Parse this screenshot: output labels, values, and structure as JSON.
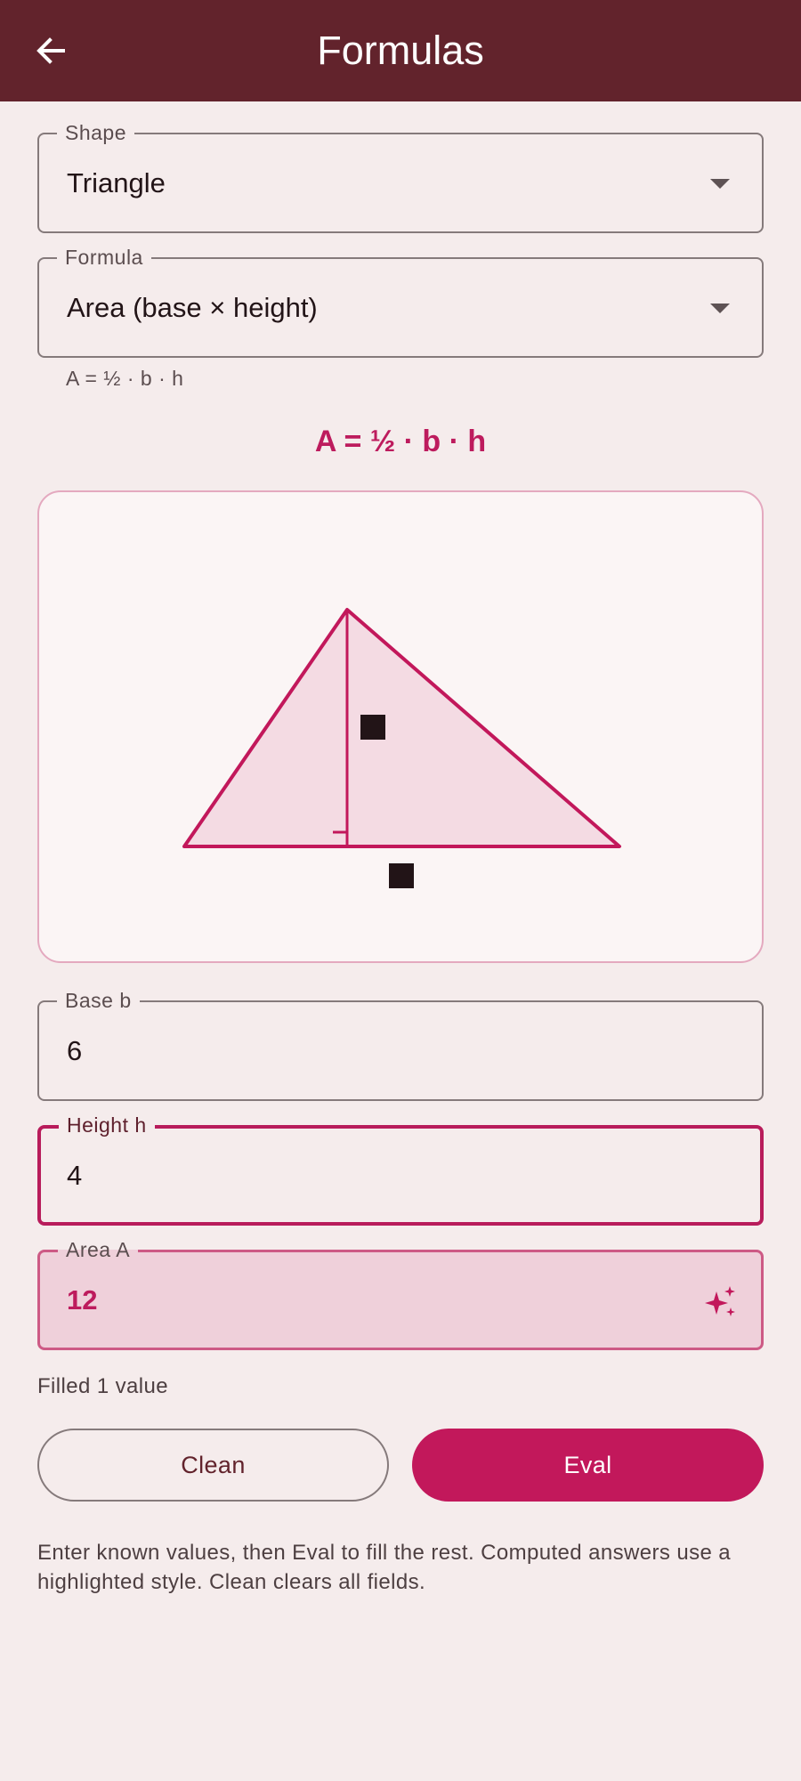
{
  "appbar": {
    "title": "Formulas",
    "back_icon": "arrow-back-icon",
    "background": "#62232c"
  },
  "shape_select": {
    "label": "Shape",
    "value": "Triangle"
  },
  "formula_select": {
    "label": "Formula",
    "value": "Area (base × height)",
    "helper": "A = ½ · b · h"
  },
  "formula_heading": "A = ½ · b · h",
  "diagram": {
    "shape": "triangle",
    "accent": "#c2185b",
    "fill": "#f4dbe3"
  },
  "inputs": {
    "base": {
      "label": "Base b",
      "value": "6"
    },
    "height": {
      "label": "Height h",
      "value": "4"
    },
    "area": {
      "label": "Area A",
      "value": "12",
      "icon": "sparkle-icon"
    }
  },
  "status": "Filled 1 value",
  "buttons": {
    "clean": "Clean",
    "eval": "Eval"
  },
  "footnote": "Enter known values, then Eval to fill the rest. Computed answers use a highlighted style. Clean clears all fields.",
  "colors": {
    "accent": "#c2185b",
    "computed_bg": "#efd0da",
    "page_bg": "#f5ecec"
  }
}
